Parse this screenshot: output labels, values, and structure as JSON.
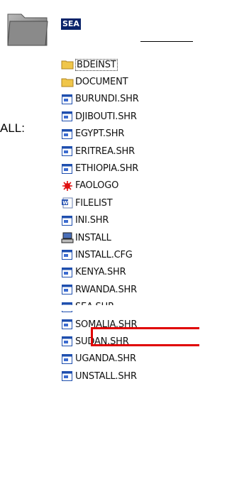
{
  "header": {
    "folder_label": "SEA"
  },
  "side_text": "ALL:",
  "files": [
    {
      "name": "BDEINST",
      "icon": "folder-icon",
      "selected": true
    },
    {
      "name": "DOCUMENT",
      "icon": "folder-icon"
    },
    {
      "name": "BURUNDI.SHR",
      "icon": "shr-file-icon"
    },
    {
      "name": "DJIBOUTI.SHR",
      "icon": "shr-file-icon"
    },
    {
      "name": "EGYPT.SHR",
      "icon": "shr-file-icon"
    },
    {
      "name": "ERITREA.SHR",
      "icon": "shr-file-icon"
    },
    {
      "name": "ETHIOPIA.SHR",
      "icon": "shr-file-icon"
    },
    {
      "name": "FAOLOGO",
      "icon": "faologo-icon"
    },
    {
      "name": "FILELIST",
      "icon": "word-doc-icon"
    },
    {
      "name": "INI.SHR",
      "icon": "shr-file-icon"
    },
    {
      "name": "INSTALL",
      "icon": "install-computer-icon"
    },
    {
      "name": "INSTALL.CFG",
      "icon": "shr-file-icon"
    },
    {
      "name": "KENYA.SHR",
      "icon": "shr-file-icon",
      "highlighted": true
    },
    {
      "name": "RWANDA.SHR",
      "icon": "shr-file-icon"
    },
    {
      "name": "SEA.SHR",
      "icon": "shr-file-icon"
    },
    {
      "name": "SOMALIA.SHR",
      "icon": "shr-file-icon"
    },
    {
      "name": "SUDAN.SHR",
      "icon": "shr-file-icon"
    },
    {
      "name": "UGANDA.SHR",
      "icon": "shr-file-icon"
    },
    {
      "name": "UNSTALL.SHR",
      "icon": "shr-file-icon"
    }
  ],
  "colors": {
    "highlight": "#e00000",
    "selection": "#0a246a",
    "folder": "#f0c64a"
  }
}
